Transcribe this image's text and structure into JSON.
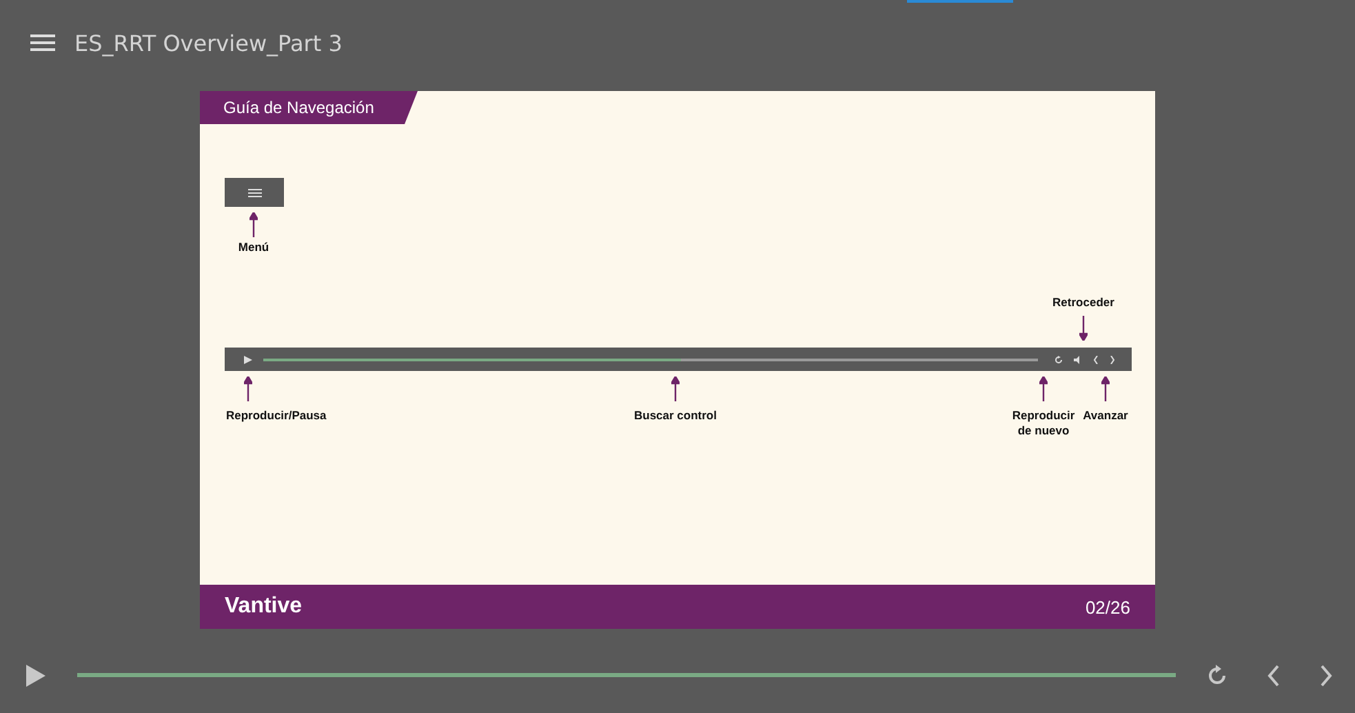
{
  "title": "ES_RRT Overview_Part 3",
  "slide": {
    "header": "Guía de Navegación",
    "menu_label": "Menú",
    "demo_bar": {
      "level": 0.54
    },
    "callouts": [
      {
        "text": "Reproducir/Pausa",
        "kind": "up"
      },
      {
        "text": "Buscar control",
        "kind": "up"
      },
      {
        "text": "Reproducir de nuevo",
        "kind": "up"
      },
      {
        "text": "Avanzar",
        "kind": "up"
      },
      {
        "text": "Retroceder",
        "kind": "down"
      }
    ],
    "logo": "Vantive",
    "page": "02/26"
  },
  "player": {
    "level": 1.0
  }
}
